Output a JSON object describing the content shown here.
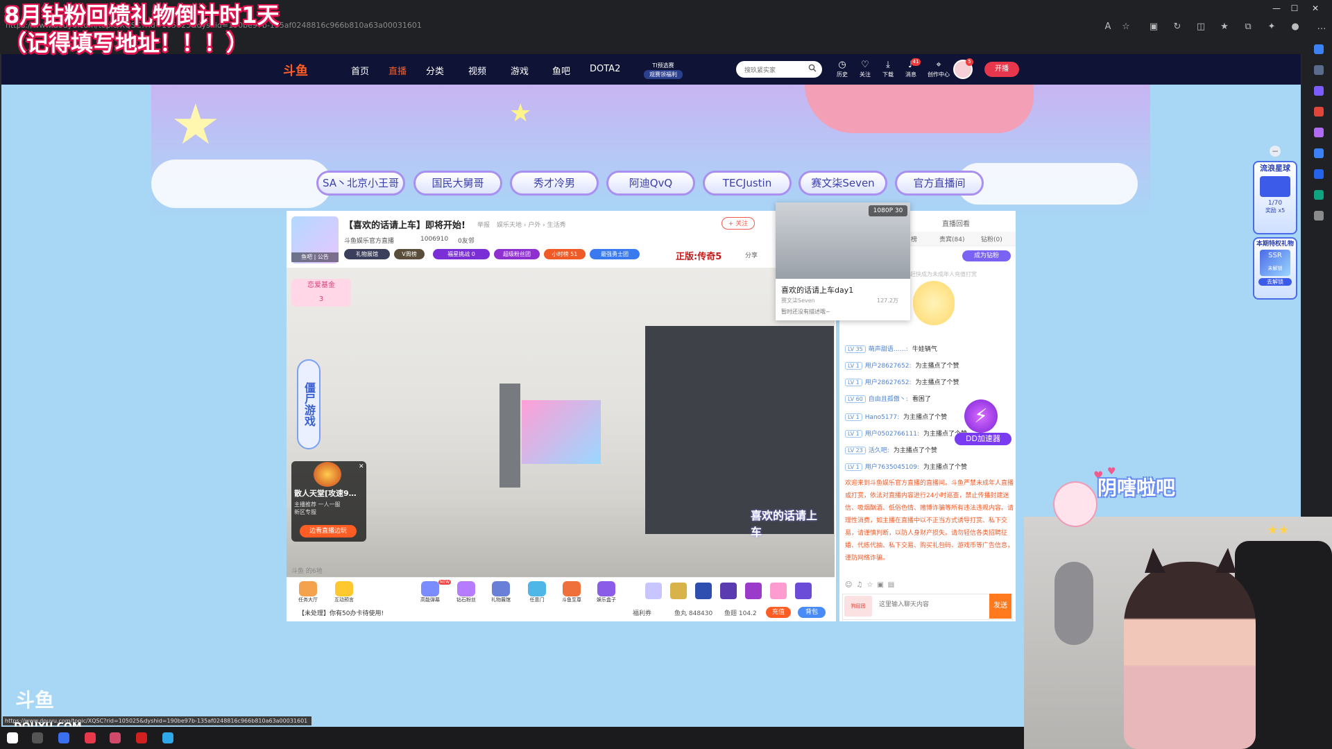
{
  "overlay": {
    "line1": "8月钻粉回馈礼物倒计时1天",
    "line2": "（记得填写地址！！！）"
  },
  "browser": {
    "url": "https://www.douyu.com/topic/XQSC?rid=105025&dyshid=190be97b-135af0248816c966b810a63a00031601",
    "status_url": "https://www.douyu.com/topic/XQSC?rid=105025&dyshid=190be97b-135af0248816c966b810a63a00031601"
  },
  "nav": {
    "logo": "斗鱼",
    "items": [
      "首页",
      "直播",
      "分类",
      "视频",
      "游戏",
      "鱼吧",
      "DOTA2"
    ],
    "ti_badge_line1": "TI预选赛",
    "ti_badge_line2": "观赛领福利",
    "search_placeholder": "搜玖紧实家",
    "tools": [
      "历史",
      "关注",
      "下载",
      "消息",
      "创作中心"
    ],
    "msg_count": "41",
    "avatar_count": "5",
    "start_live": "开播"
  },
  "streamer_tabs": [
    "SA丶北京小王哥",
    "国民大舅哥",
    "秀才冷男",
    "阿迪QvQ",
    "TECJustin",
    "赛文柒Seven",
    "官方直播间"
  ],
  "room": {
    "thumb_label_1": "鱼吧",
    "thumb_label_2": "公告",
    "title": "【喜欢的话请上车】即将开始!",
    "report": "举报",
    "category": "娱乐天地 › 户外 › 生活秀",
    "follow": "+ 关注",
    "official": "斗鱼娱乐官方直播",
    "heat": "1006910",
    "fans": "0友邻",
    "badges": [
      "礼物展馆",
      "V周榜",
      "福星挑战 0",
      "超级粉丝团",
      "小时榜 51",
      "最强勇士团"
    ],
    "game_status": "正版:传奇5",
    "share": "分享"
  },
  "video": {
    "mood_bag": "恋爱基金",
    "vertical_sign": "僵尸游戏",
    "promo_title": "散人天堂[攻速9…",
    "promo_sub_1": "主播推荐",
    "promo_sub_2": "一人一服",
    "promo_sub_3": "新区专服",
    "promo_button": "边看直播边玩",
    "watermark": "喜欢的话请上车",
    "footer_text": "斗鱼 的6地"
  },
  "gift_bar": {
    "items": [
      "任务大厅",
      "互动预言",
      "高能弹幕",
      "钻石粉丝",
      "礼物展馆",
      "任意门",
      "斗鱼至尊",
      "娱乐盒子"
    ],
    "new_tag": "NEW",
    "notice": "【未处理】你有50办卡待使用!",
    "welfare": "福利券",
    "yuwan": "鱼丸 848430",
    "yuchi": "鱼翅 104.2",
    "recharge": "充值",
    "backpack": "背包"
  },
  "chat": {
    "replay": "直播回看",
    "tabs": [
      "周榜",
      "贵宾(84)",
      "钻粉(0)"
    ],
    "become_fan": "成为钻粉",
    "hint": "赶快成为未成年人充值打赏",
    "messages": [
      {
        "lv": "LV 35",
        "user": "萌声甜语……:",
        "text": "牛娃辆气"
      },
      {
        "lv": "LV 1",
        "user": "用户28627652:",
        "text": "为主播点了个赞"
      },
      {
        "lv": "LV 1",
        "user": "用户28627652:",
        "text": "为主播点了个赞"
      },
      {
        "lv": "LV 60",
        "user": "自由且孤傲丶:",
        "text": "看困了"
      },
      {
        "lv": "LV 1",
        "user": "Hano5177:",
        "text": "为主播点了个赞"
      },
      {
        "lv": "LV 1",
        "user": "用户0502766111:",
        "text": "为主播点了个赞"
      },
      {
        "lv": "LV 23",
        "user": "活久吧:",
        "text": "为主播点了个赞"
      },
      {
        "lv": "LV 1",
        "user": "用户7635045109:",
        "text": "为主播点了个赞"
      }
    ],
    "system": "欢迎来到斗鱼娱乐官方直播的直播间。斗鱼严禁未成年人直播或打赏，依法对直播内容进行24小时巡查，禁止传播封建迷信、吸烟酗酒、低俗色情、赌博诈骗等所有违法违规内容。请理性消费，如主播在直播中以不正当方式诱导打赏、私下交易，请谨慎判断，以防人身财产损失。请勿轻信各类招聘征婚、代练代抽、私下交易、购买礼包码、游戏币等广告信息，谨防网络诈骗。",
    "input_placeholder": "这里输入聊天内容",
    "send": "发送",
    "dd_accel": "DD加速器",
    "fan_tag": "狗屁团"
  },
  "hover_preview": {
    "quality": "1080P 30",
    "title": "喜欢的话请上车day1",
    "streamer": "赛文柒Seven",
    "heat": "127.2万",
    "desc": "暂时还没有描述哦~"
  },
  "floaters": {
    "panel1_title": "流浪星球",
    "panel1_sub": "1/70",
    "panel1_reward": "奖励",
    "panel1_count": "x5",
    "panel2_title": "本期特权礼物",
    "panel2_badge": "SSR",
    "panel2_sub": "未解锁",
    "panel2_btn": "去解锁"
  },
  "cam": {
    "sticker_text": "阴嗐啦吧"
  },
  "watermark": {
    "logo": "斗鱼",
    "site": "DOUYU.COM"
  }
}
